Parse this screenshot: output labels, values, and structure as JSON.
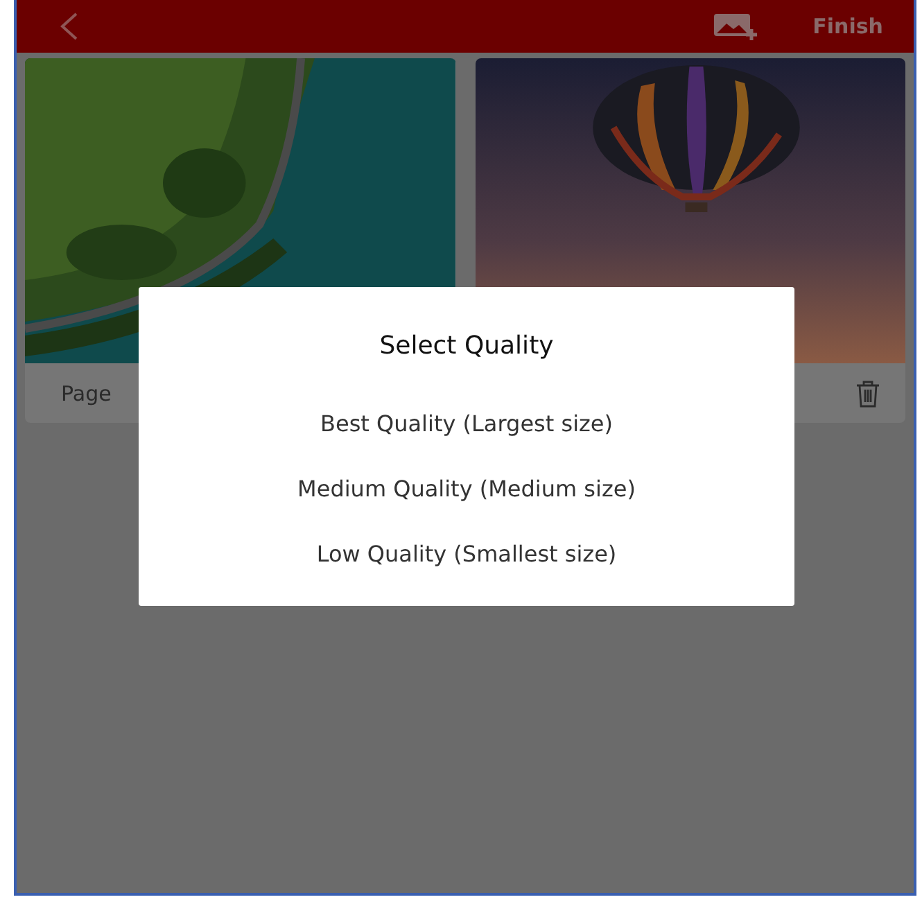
{
  "header": {
    "finish_button": "Finish"
  },
  "pages": [
    {
      "label": "Page",
      "kind": "landscape"
    },
    {
      "kind": "balloon"
    }
  ],
  "dialog": {
    "title": "Select Quality",
    "options": [
      "Best Quality (Largest size)",
      "Medium Quality (Medium size)",
      "Low Quality (Smallest size)"
    ]
  }
}
